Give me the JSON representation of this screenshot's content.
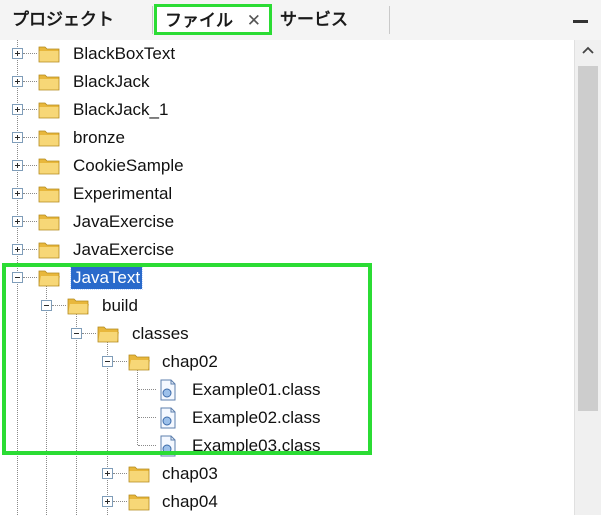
{
  "tabs": {
    "projects": "プロジェクト",
    "files": "ファイル",
    "files_close": "✕",
    "services": "サービス"
  },
  "tree": {
    "items": [
      {
        "label": "BlackBoxText",
        "expanded": false,
        "icon": "folder-icon"
      },
      {
        "label": "BlackJack",
        "expanded": false,
        "icon": "folder-icon"
      },
      {
        "label": "BlackJack_1",
        "expanded": false,
        "icon": "folder-icon"
      },
      {
        "label": "bronze",
        "expanded": false,
        "icon": "folder-icon"
      },
      {
        "label": "CookieSample",
        "expanded": false,
        "icon": "folder-icon"
      },
      {
        "label": "Experimental",
        "expanded": false,
        "icon": "folder-icon"
      },
      {
        "label": "JavaExercise",
        "expanded": false,
        "icon": "folder-icon"
      },
      {
        "label": "JavaExercise",
        "expanded": false,
        "icon": "folder-icon"
      },
      {
        "label": "JavaText",
        "expanded": true,
        "selected": true,
        "icon": "folder-icon"
      },
      {
        "label": "build",
        "expanded": true,
        "icon": "folder-icon"
      },
      {
        "label": "classes",
        "expanded": true,
        "icon": "folder-icon"
      },
      {
        "label": "chap02",
        "expanded": true,
        "icon": "folder-icon"
      },
      {
        "label": "Example01.class",
        "icon": "class-file-icon"
      },
      {
        "label": "Example02.class",
        "icon": "class-file-icon"
      },
      {
        "label": "Example03.class",
        "icon": "class-file-icon"
      },
      {
        "label": "chap03",
        "expanded": false,
        "icon": "folder-icon"
      },
      {
        "label": "chap04",
        "expanded": false,
        "icon": "folder-icon"
      }
    ]
  },
  "colors": {
    "highlight": "#2bdc34",
    "selection": "#2a6acb",
    "folder": "#f2c94c"
  }
}
